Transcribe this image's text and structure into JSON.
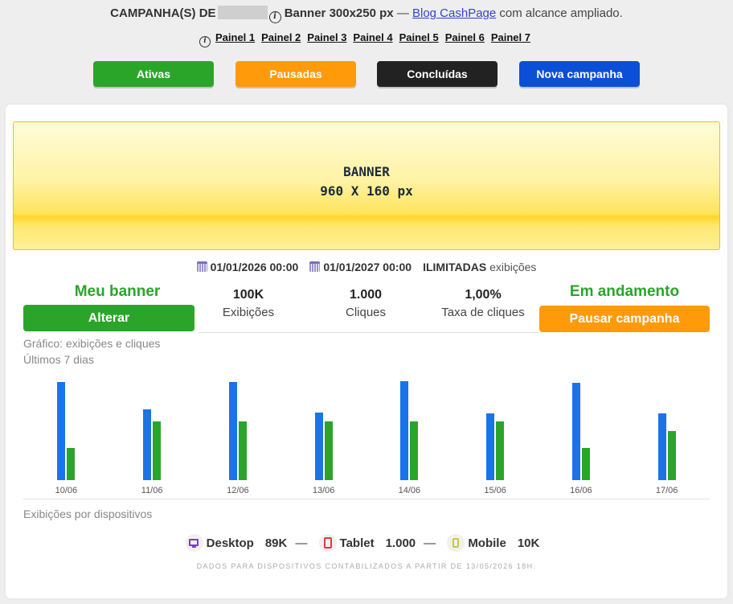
{
  "header": {
    "campaign_prefix": "CAMPANHA(S) DE",
    "banner_label": "Banner 300x250 px",
    "separator": "—",
    "blog_link": "Blog CashPage",
    "reach_text": "com alcance ampliado."
  },
  "panels": [
    "Painel 1",
    "Painel 2",
    "Painel 3",
    "Painel 4",
    "Painel 5",
    "Painel 6",
    "Painel 7"
  ],
  "tabs": {
    "active": "Ativas",
    "paused": "Pausadas",
    "finished": "Concluídas",
    "new": "Nova campanha"
  },
  "banner": {
    "line1": "BANNER",
    "line2": "960 X 160 px"
  },
  "dates": {
    "start": "01/01/2026 00:00",
    "end": "01/01/2027 00:00",
    "limit_bold": "ILIMITADAS",
    "limit_text": "exibições"
  },
  "left": {
    "title": "Meu banner",
    "button": "Alterar"
  },
  "right": {
    "status": "Em andamento",
    "button": "Pausar campanha"
  },
  "stats": [
    {
      "value": "100K",
      "label": "Exibições"
    },
    {
      "value": "1.000",
      "label": "Cliques"
    },
    {
      "value": "1,00%",
      "label": "Taxa de cliques"
    }
  ],
  "chart_title": {
    "line1": "Gráfico: exibições e cliques",
    "line2": "Últimos 7 dias"
  },
  "chart_data": {
    "type": "bar",
    "categories": [
      "10/06",
      "11/06",
      "12/06",
      "13/06",
      "14/06",
      "15/06",
      "16/06",
      "17/06"
    ],
    "series": [
      {
        "values": [
          100,
          72,
          100,
          69,
          101,
          68,
          99,
          68
        ],
        "color": "#1a73e8"
      },
      {
        "values": [
          33,
          60,
          60,
          60,
          60,
          60,
          33,
          50
        ],
        "color": "#2aa52a"
      }
    ],
    "ylim": [
      0,
      105
    ]
  },
  "devices": {
    "title": "Exibições por dispositivos",
    "desktop_label": "Desktop",
    "desktop_value": "89K",
    "tablet_label": "Tablet",
    "tablet_value": "1.000",
    "mobile_label": "Mobile",
    "mobile_value": "10K",
    "dash": "—",
    "footnote": "DADOS PARA DISPOSITIVOS CONTABILIZADOS A PARTIR DE 13/05/2026 18H."
  }
}
